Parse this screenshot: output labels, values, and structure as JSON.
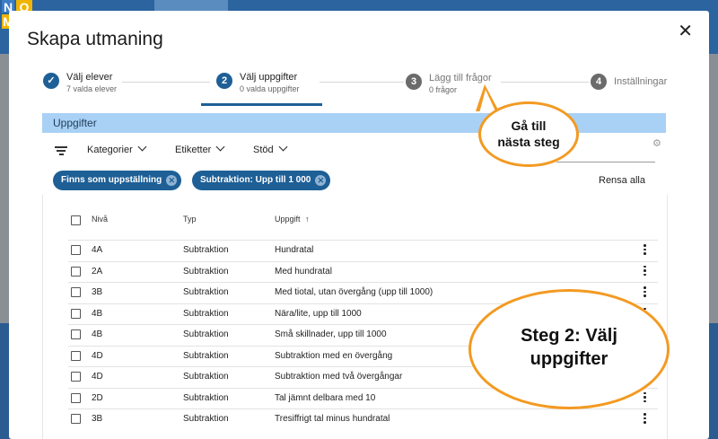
{
  "background": {
    "tiles": [
      "N",
      "O",
      "M"
    ]
  },
  "dialog": {
    "title": "Skapa utmaning",
    "close_glyph": "✕",
    "steps": [
      {
        "number": "✓",
        "label": "Välj elever",
        "sub": "7 valda elever",
        "state": "done"
      },
      {
        "number": "2",
        "label": "Välj uppgifter",
        "sub": "0 valda uppgifter",
        "state": "active"
      },
      {
        "number": "3",
        "label": "Lägg till frågor",
        "sub": "0 frågor",
        "state": "inactive"
      },
      {
        "number": "4",
        "label": "Inställningar",
        "sub": "",
        "state": "inactive"
      }
    ],
    "section_title": "Uppgifter",
    "filters": {
      "category": "Kategorier",
      "tags": "Etiketter",
      "support": "Stöd"
    },
    "chips": [
      {
        "label": "Finns som uppställning"
      },
      {
        "label": "Subtraktion: Upp till 1 000"
      }
    ],
    "clear_all": "Rensa alla",
    "table": {
      "headers": {
        "level": "Nivå",
        "type": "Typ",
        "task": "Uppgift",
        "sort_glyph": "↑"
      },
      "rows": [
        {
          "level": "4A",
          "type": "Subtraktion",
          "task": "Hundratal"
        },
        {
          "level": "2A",
          "type": "Subtraktion",
          "task": "Med hundratal"
        },
        {
          "level": "3B",
          "type": "Subtraktion",
          "task": "Med tiotal, utan övergång (upp till 1000)"
        },
        {
          "level": "4B",
          "type": "Subtraktion",
          "task": "Nära/lite, upp till 1000"
        },
        {
          "level": "4B",
          "type": "Subtraktion",
          "task": "Små skillnader, upp till 1000"
        },
        {
          "level": "4D",
          "type": "Subtraktion",
          "task": "Subtraktion med en övergång"
        },
        {
          "level": "4D",
          "type": "Subtraktion",
          "task": "Subtraktion med två övergångar"
        },
        {
          "level": "2D",
          "type": "Subtraktion",
          "task": "Tal jämnt delbara med 10"
        },
        {
          "level": "3B",
          "type": "Subtraktion",
          "task": "Tresiffrigt tal minus hundratal"
        }
      ]
    }
  },
  "callouts": {
    "next_step": {
      "line1": "Gå till",
      "line2": "nästa steg"
    },
    "step2": {
      "line1": "Steg 2: Välj",
      "line2": "uppgifter"
    }
  },
  "colors": {
    "accent": "#1e5f96",
    "done": "#1e5f96",
    "inactive": "#6b6b6b",
    "callout_border": "#f39a22",
    "section_header": "#a9d1f5"
  }
}
